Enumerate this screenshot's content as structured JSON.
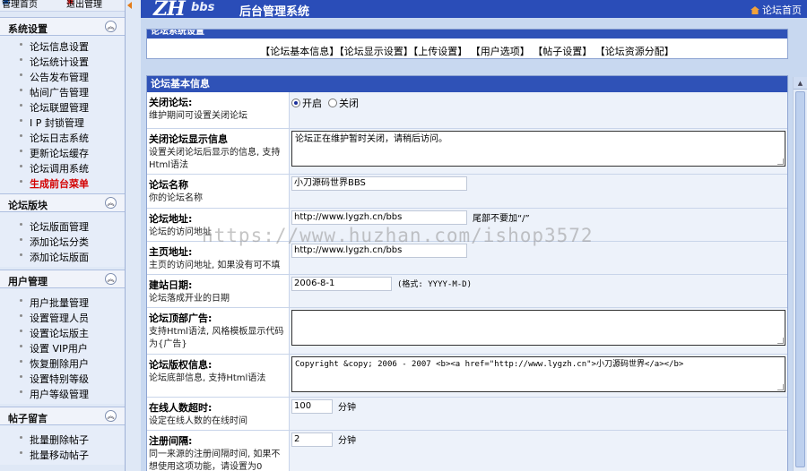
{
  "topbar": {
    "admin_home": "管理首页",
    "logout": "退出管理"
  },
  "header": {
    "logo": "ZH",
    "logo_sub": "bbs",
    "title": "后台管理系统",
    "home_link": "论坛首页"
  },
  "sidebar": {
    "groups": [
      {
        "title": "系统设置",
        "items": [
          "论坛信息设置",
          "论坛统计设置",
          "公告发布管理",
          "帖间广告管理",
          "论坛联盟管理",
          "I P 封锁管理",
          "论坛日志系统",
          "更新论坛缓存",
          "论坛调用系统",
          "生成前台菜单"
        ]
      },
      {
        "title": "论坛版块",
        "items": [
          "论坛版面管理",
          "添加论坛分类",
          "添加论坛版面"
        ]
      },
      {
        "title": "用户管理",
        "items": [
          "用户批量管理",
          "设置管理人员",
          "设置论坛版主",
          "设置 VIP用户",
          "恢复删除用户",
          "设置特别等级",
          "用户等级管理"
        ]
      },
      {
        "title": "帖子留言",
        "items": [
          "批量删除帖子",
          "批量移动帖子"
        ]
      }
    ]
  },
  "settings_panel": {
    "title": "论坛系统设置",
    "links": [
      "【论坛基本信息】",
      "【论坛显示设置】",
      "【上传设置】",
      "【用户选项】",
      "【帖子设置】",
      "【论坛资源分配】"
    ]
  },
  "basic_panel": {
    "title": "论坛基本信息",
    "close_forum": {
      "label": "关闭论坛:",
      "desc": "维护期间可设置关闭论坛",
      "opt_on": "开启",
      "opt_off": "关闭"
    },
    "close_msg": {
      "label": "关闭论坛显示信息",
      "desc": "设置关闭论坛后显示的信息, 支持Html语法",
      "value": "论坛正在维护暂时关闭，请稍后访问。"
    },
    "forum_name": {
      "label": "论坛名称",
      "desc": "你的论坛名称",
      "value": "小刀源码世界BBS"
    },
    "forum_url": {
      "label": "论坛地址:",
      "desc": "论坛的访问地址",
      "value": "http://www.lygzh.cn/bbs",
      "note": "尾部不要加“/”"
    },
    "home_url": {
      "label": "主页地址:",
      "desc": "主页的访问地址, 如果没有可不填",
      "value": "http://www.lygzh.cn/bbs"
    },
    "founded": {
      "label": "建站日期:",
      "desc": "论坛落成开业的日期",
      "value": "2006-8-1",
      "note": "(格式: YYYY-M-D)"
    },
    "top_ad": {
      "label": "论坛顶部广告:",
      "desc": "支持Html语法, 风格模板显示代码为{广告}",
      "value": ""
    },
    "copyright": {
      "label": "论坛版权信息:",
      "desc": "论坛底部信息, 支持Html语法",
      "value": "Copyright &copy; 2006 - 2007 <b><a href=\"http://www.lygzh.cn\">小刀源码世界</a></b>"
    },
    "online_timeout": {
      "label": "在线人数超时:",
      "desc": "设定在线人数的在线时间",
      "value": "100",
      "unit": "分钟"
    },
    "reg_interval": {
      "label": "注册间隔:",
      "desc": "同一来源的注册间隔时间, 如果不想使用这项功能，请设置为0",
      "value": "2",
      "unit": "分钟"
    }
  },
  "watermark": "https://www.huzhan.com/ishop3572",
  "colors": {
    "header_blue": "#2a4db8",
    "sidebar_bg": "#dfe8f6",
    "highlight_red": "#d40000"
  }
}
